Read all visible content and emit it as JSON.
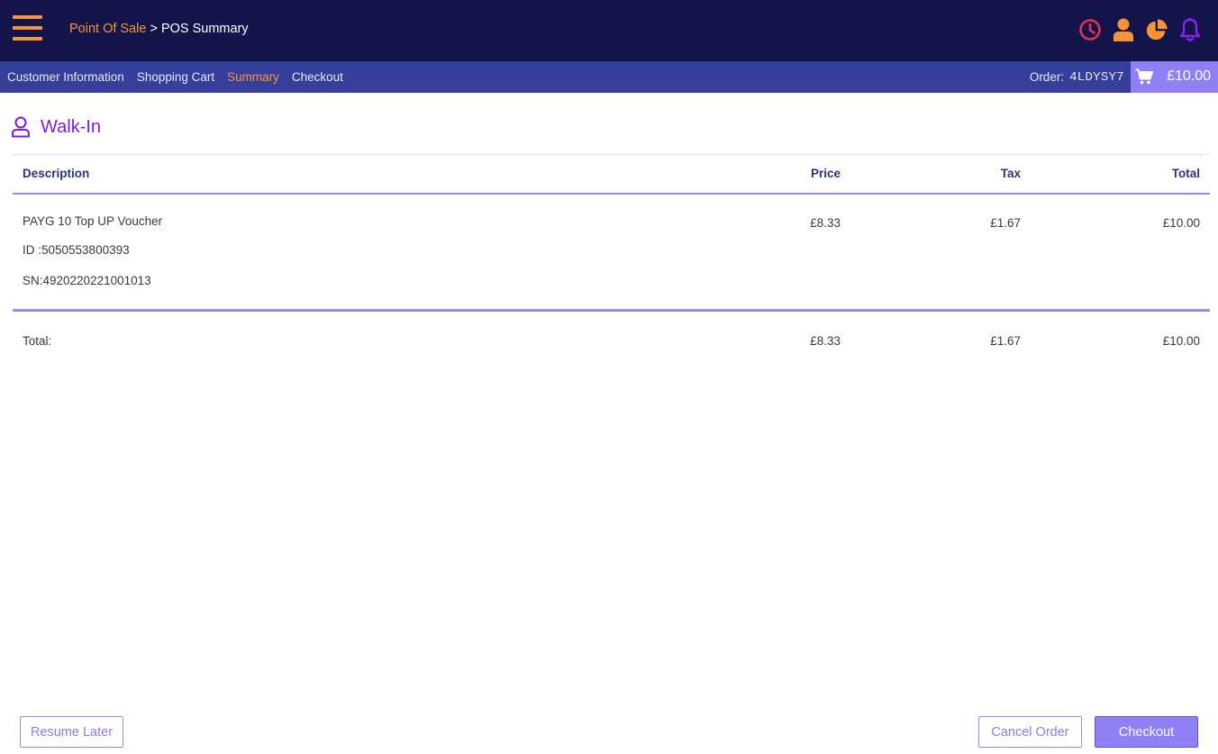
{
  "header": {
    "breadcrumb_root": "Point Of Sale",
    "breadcrumb_sep": " > ",
    "breadcrumb_current": "POS Summary",
    "icons": [
      "clock-icon",
      "user-icon",
      "pie-chart-icon",
      "bell-icon"
    ]
  },
  "subnav": {
    "tabs": [
      {
        "label": "Customer Information",
        "active": false
      },
      {
        "label": "Shopping Cart",
        "active": false
      },
      {
        "label": "Summary",
        "active": true
      },
      {
        "label": "Checkout",
        "active": false
      }
    ],
    "order_label": "Order:",
    "order_code": "4LDYSY7",
    "cart_total": "£10.00"
  },
  "customer": {
    "name": "Walk-In"
  },
  "table": {
    "headers": {
      "description": "Description",
      "price": "Price",
      "tax": "Tax",
      "total": "Total"
    },
    "rows": [
      {
        "description": "PAYG 10 Top UP Voucher",
        "id": "ID :5050553800393",
        "sn": "SN:4920220221001013",
        "price": "£8.33",
        "tax": "£1.67",
        "total": "£10.00"
      }
    ],
    "totals": {
      "label": "Total:",
      "price": "£8.33",
      "tax": "£1.67",
      "total": "£10.00"
    }
  },
  "footer": {
    "resume_label": "Resume Later",
    "cancel_label": "Cancel Order",
    "checkout_label": "Checkout"
  },
  "colors": {
    "header_bg": "#13144a",
    "subnav_bg": "#353e98",
    "accent_orange": "#f7943a",
    "accent_purple": "#7a1dde",
    "button_purple": "#9080f5",
    "clock_red": "#e0325a"
  }
}
